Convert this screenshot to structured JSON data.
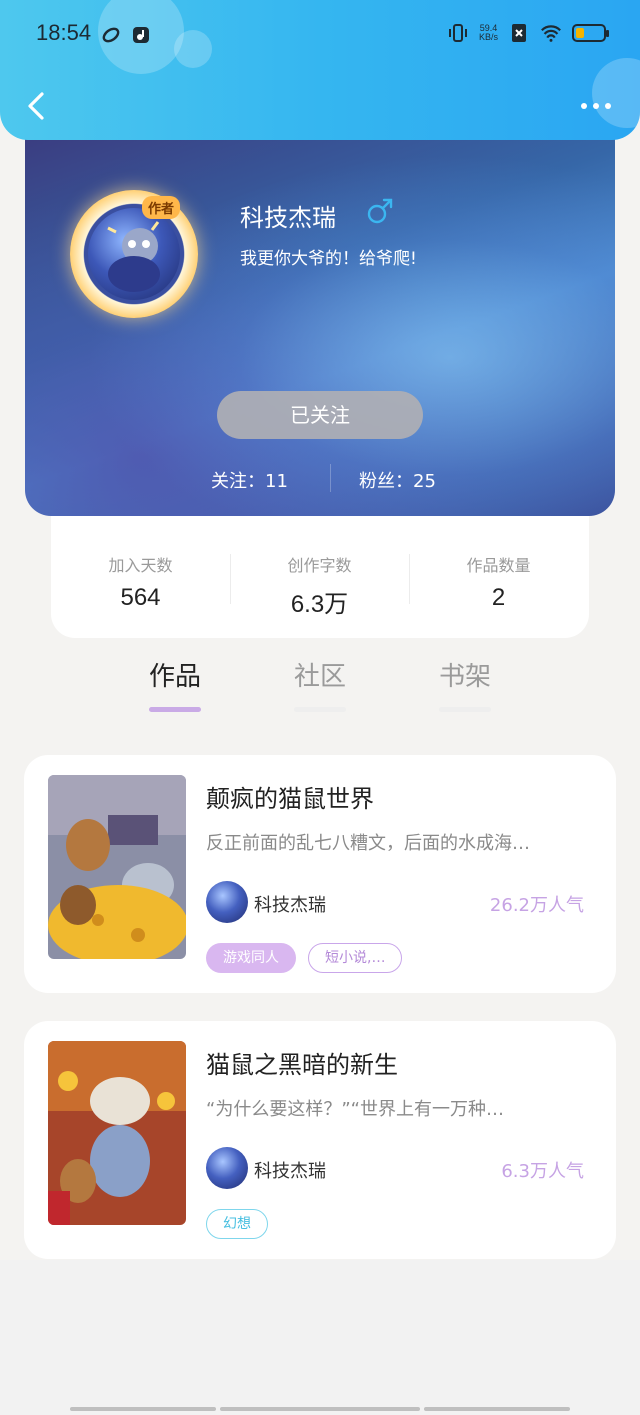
{
  "status_bar": {
    "time": "18:54",
    "net_speed_value": "59.4",
    "net_speed_unit": "KB/s",
    "battery_level_percent": 30,
    "battery_color": "#f5b400"
  },
  "header": {
    "back_icon": "chevron-left-icon",
    "more_icon": "more-horizontal-icon",
    "gradient_colors": [
      "#4ec8ee",
      "#2aa6f2"
    ]
  },
  "profile": {
    "avatar_badge": "作者",
    "name": "科技杰瑞",
    "gender_symbol": "♂",
    "gender_color": "#3bb6f0",
    "bio": "我更你大爷的！给爷爬!",
    "follow_button": "已关注",
    "following_label": "关注：11",
    "followers_label": "粉丝：25"
  },
  "stats": [
    {
      "label": "加入天数",
      "value": "564"
    },
    {
      "label": "创作字数",
      "value": "6.3万"
    },
    {
      "label": "作品数量",
      "value": "2"
    }
  ],
  "tabs": [
    {
      "label": "作品",
      "active": true
    },
    {
      "label": "社区",
      "active": false
    },
    {
      "label": "书架",
      "active": false
    }
  ],
  "works": [
    {
      "title": "颠疯的猫鼠世界",
      "description": "反正前面的乱七八糟文，后面的水成海…",
      "author": "科技杰瑞",
      "popularity": "26.2万人气",
      "tags": [
        {
          "label": "游戏同人",
          "style": "filled"
        },
        {
          "label": "短小说,…",
          "style": "outline"
        }
      ]
    },
    {
      "title": "猫鼠之黑暗的新生",
      "description": "“为什么要这样？”“世界上有一万种…",
      "author": "科技杰瑞",
      "popularity": "6.3万人气",
      "tags": [
        {
          "label": "幻想",
          "style": "cyan"
        }
      ]
    }
  ],
  "colors": {
    "accent_purple": "#c9aae6",
    "popularity_purple": "#c6a3e4",
    "page_background": "#f4f3f1"
  }
}
